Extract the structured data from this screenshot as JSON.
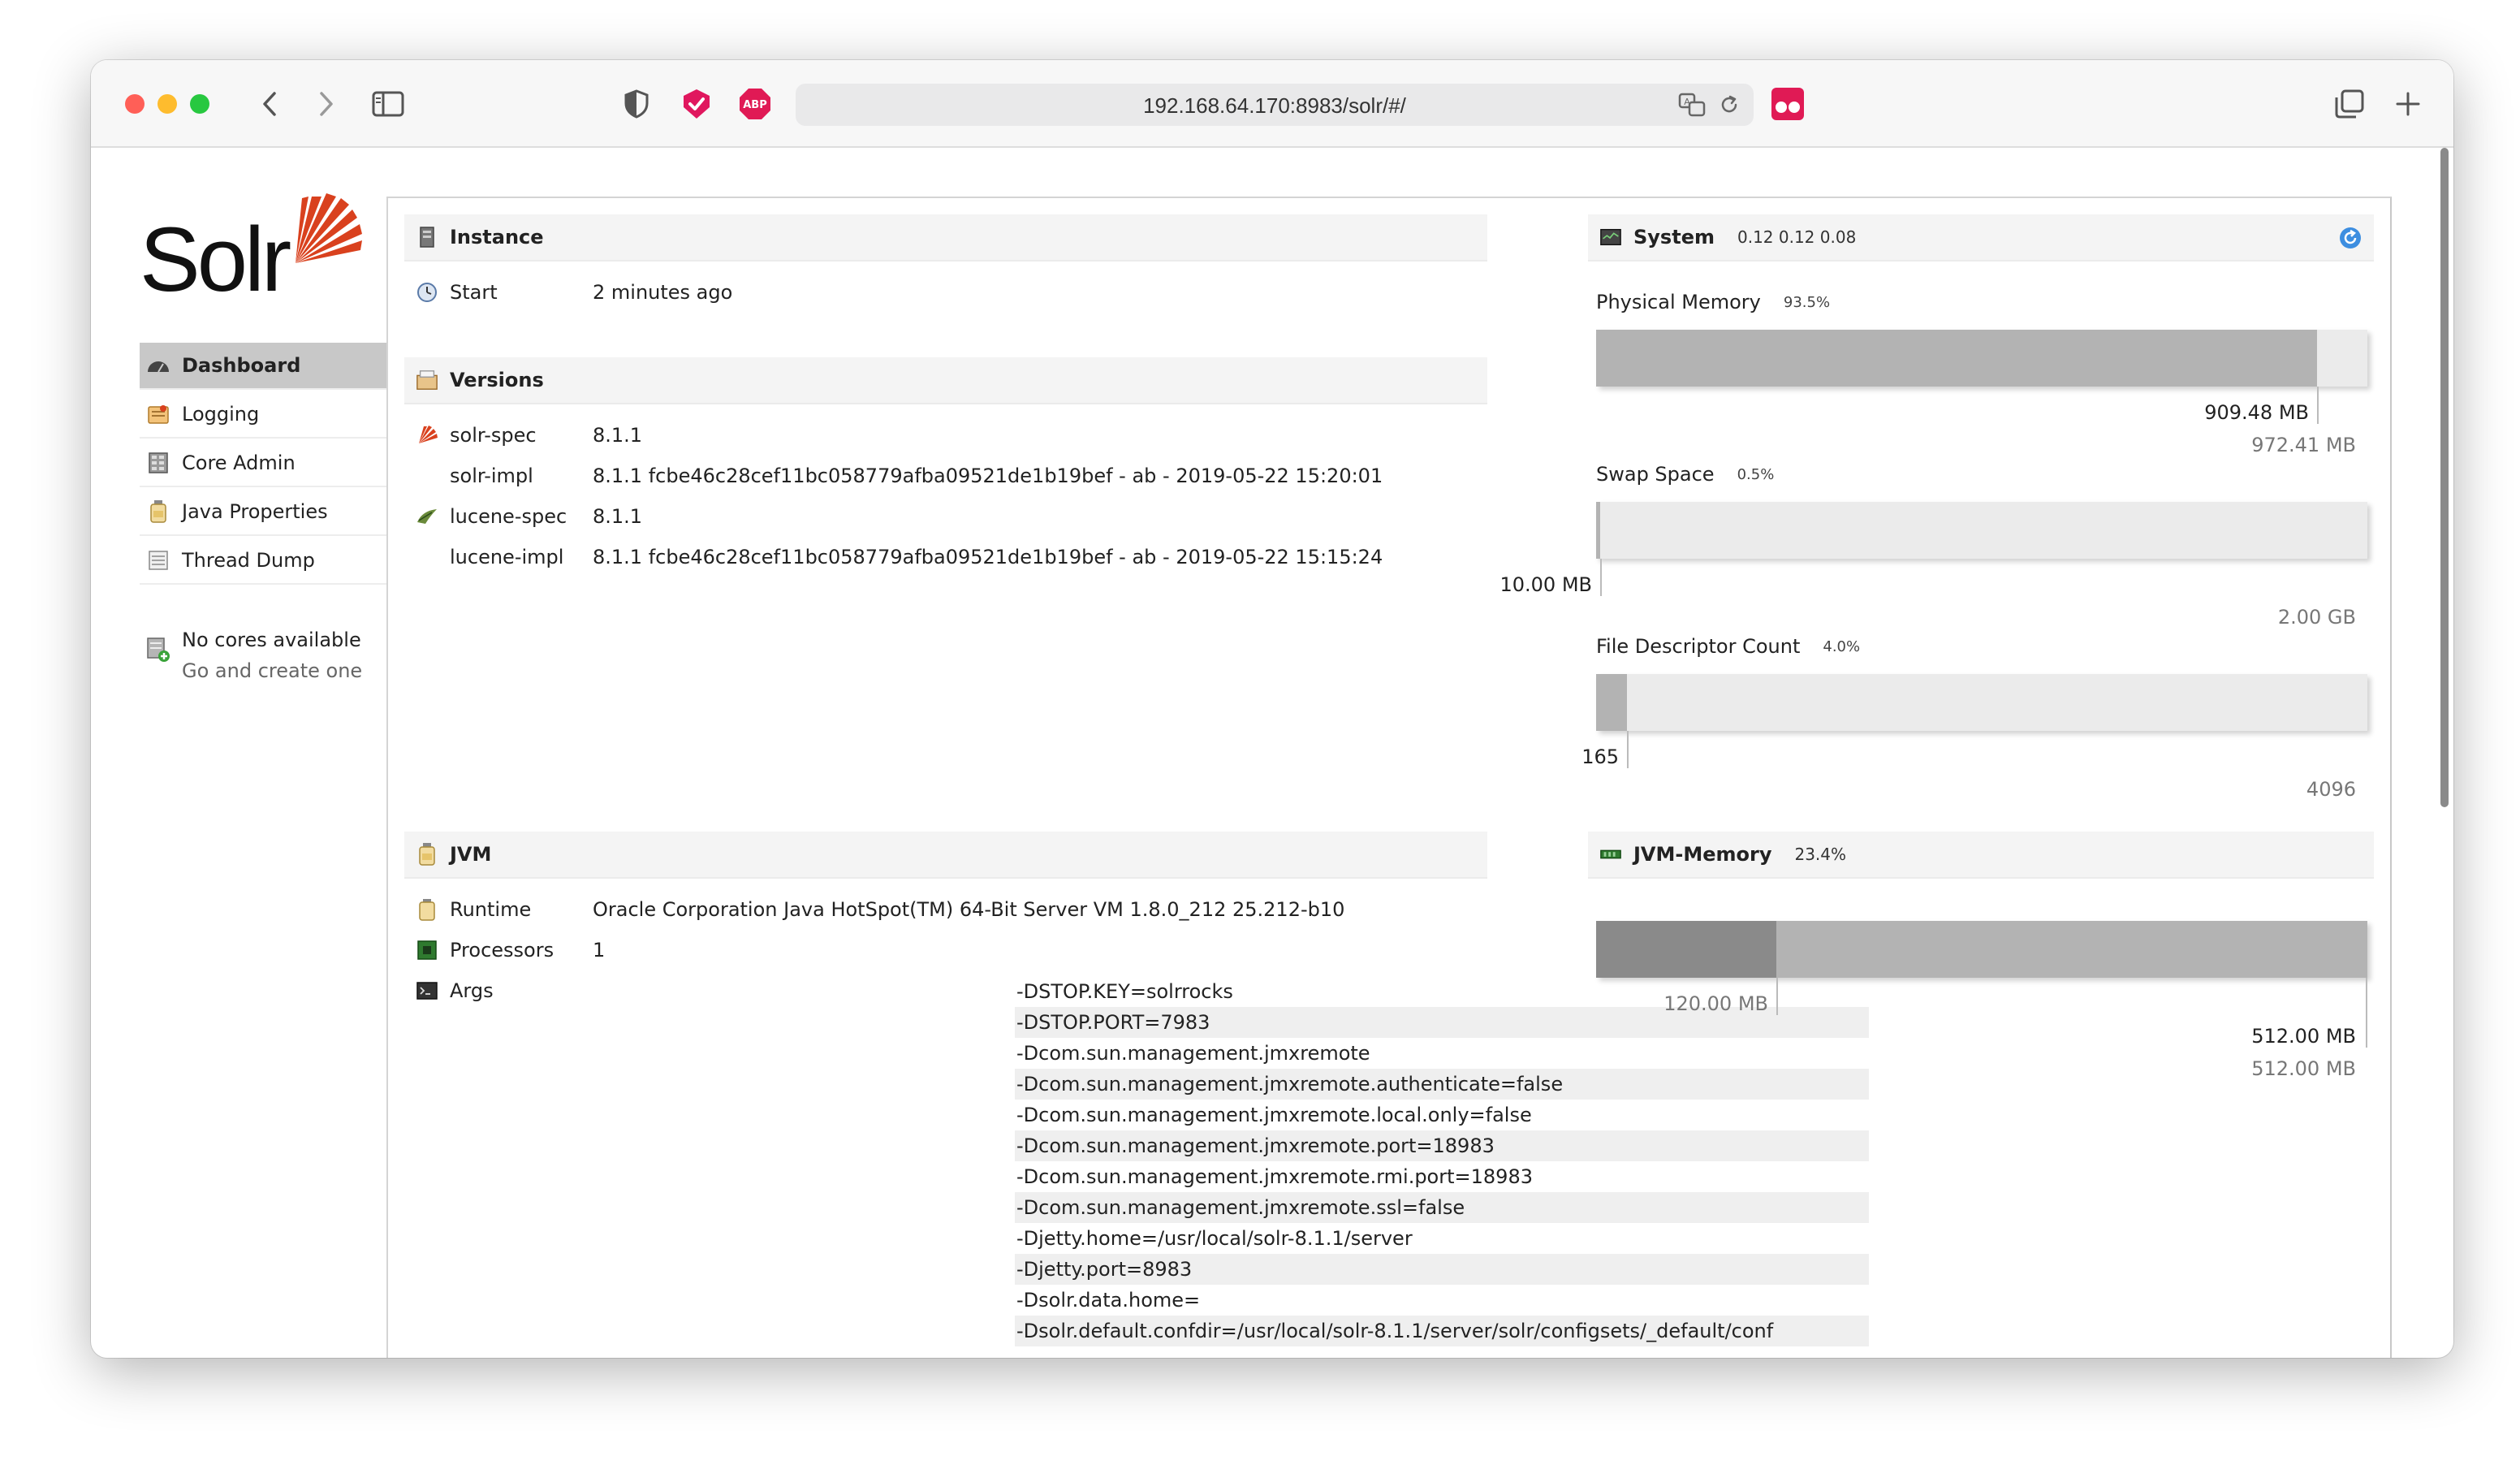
{
  "browser": {
    "url": "192.168.64.170:8983/solr/#/"
  },
  "logo": {
    "text": "Solr"
  },
  "nav": {
    "items": [
      {
        "label": "Dashboard",
        "icon": "dashboard-icon",
        "active": true
      },
      {
        "label": "Logging",
        "icon": "logging-icon"
      },
      {
        "label": "Core Admin",
        "icon": "core-admin-icon"
      },
      {
        "label": "Java Properties",
        "icon": "java-icon"
      },
      {
        "label": "Thread Dump",
        "icon": "thread-dump-icon"
      }
    ],
    "no_cores": "No cores available",
    "create_core": "Go and create one"
  },
  "instance": {
    "title": "Instance",
    "start_label": "Start",
    "start_value": "2 minutes ago"
  },
  "versions": {
    "title": "Versions",
    "rows": [
      {
        "key": "solr-spec",
        "value": "8.1.1"
      },
      {
        "key": "solr-impl",
        "value": "8.1.1 fcbe46c28cef11bc058779afba09521de1b19bef - ab - 2019-05-22 15:20:01"
      },
      {
        "key": "lucene-spec",
        "value": "8.1.1"
      },
      {
        "key": "lucene-impl",
        "value": "8.1.1 fcbe46c28cef11bc058779afba09521de1b19bef - ab - 2019-05-22 15:15:24"
      }
    ]
  },
  "jvm": {
    "title": "JVM",
    "runtime_label": "Runtime",
    "runtime_value": "Oracle Corporation Java HotSpot(TM) 64-Bit Server VM 1.8.0_212 25.212-b10",
    "processors_label": "Processors",
    "processors_value": "1",
    "args_label": "Args",
    "args": [
      "-DSTOP.KEY=solrrocks",
      "-DSTOP.PORT=7983",
      "-Dcom.sun.management.jmxremote",
      "-Dcom.sun.management.jmxremote.authenticate=false",
      "-Dcom.sun.management.jmxremote.local.only=false",
      "-Dcom.sun.management.jmxremote.port=18983",
      "-Dcom.sun.management.jmxremote.rmi.port=18983",
      "-Dcom.sun.management.jmxremote.ssl=false",
      "-Djetty.home=/usr/local/solr-8.1.1/server",
      "-Djetty.port=8983",
      "-Dsolr.data.home=",
      "-Dsolr.default.confdir=/usr/local/solr-8.1.1/server/solr/configsets/_default/conf"
    ]
  },
  "system": {
    "title": "System",
    "load": "0.12 0.12 0.08",
    "physical_memory": {
      "label": "Physical Memory",
      "pct": "93.5%",
      "fraction": 0.935,
      "used": "909.48 MB",
      "total": "972.41 MB"
    },
    "swap_space": {
      "label": "Swap Space",
      "pct": "0.5%",
      "fraction": 0.005,
      "used": "10.00 MB",
      "total": "2.00 GB"
    },
    "file_descriptor": {
      "label": "File Descriptor Count",
      "pct": "4.0%",
      "fraction": 0.04,
      "used": "165",
      "total": "4096"
    }
  },
  "jvm_memory": {
    "title": "JVM-Memory",
    "pct": "23.4%",
    "used_fraction": 0.234,
    "used": "120.00 MB",
    "max": "512.00 MB",
    "total": "512.00 MB"
  },
  "colors": {
    "solr_red": "#d9411e",
    "bar_bg": "#ebebeb",
    "bar_fill": "#b3b3b3",
    "bar_used": "#8a8a8a"
  }
}
